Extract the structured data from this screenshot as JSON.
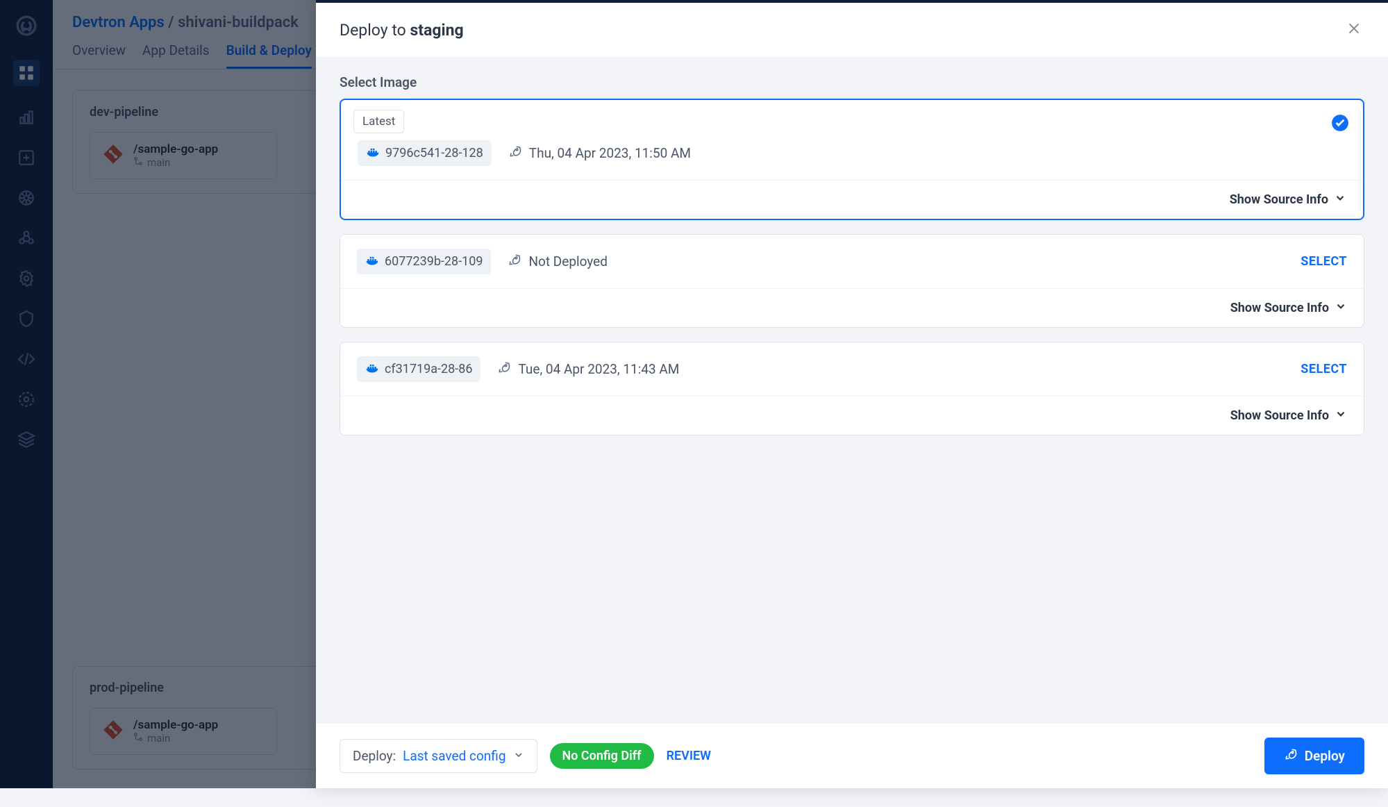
{
  "breadcrumb": {
    "root": "Devtron Apps",
    "sep": "/",
    "current": "shivani-buildpack"
  },
  "tabs": {
    "overview": "Overview",
    "details": "App Details",
    "build": "Build & Deploy"
  },
  "pipelines": {
    "dev": {
      "title": "dev-pipeline",
      "app": "/sample-go-app",
      "branch": "main"
    },
    "prod": {
      "title": "prod-pipeline",
      "app": "/sample-go-app",
      "branch": "main"
    }
  },
  "modal": {
    "title_prefix": "Deploy to ",
    "env": "staging",
    "section": "Select Image",
    "latest_label": "Latest",
    "source_toggle": "Show Source Info",
    "select_label": "SELECT",
    "images": [
      {
        "tag": "9796c541-28-128",
        "status": "Thu, 04 Apr 2023, 11:50 AM"
      },
      {
        "tag": "6077239b-28-109",
        "status": "Not Deployed"
      },
      {
        "tag": "cf31719a-28-86",
        "status": "Tue, 04 Apr 2023, 11:43 AM"
      }
    ]
  },
  "footer": {
    "deploy_label": "Deploy:",
    "config": "Last saved config",
    "diff": "No Config Diff",
    "review": "REVIEW",
    "deploy_btn": "Deploy"
  }
}
